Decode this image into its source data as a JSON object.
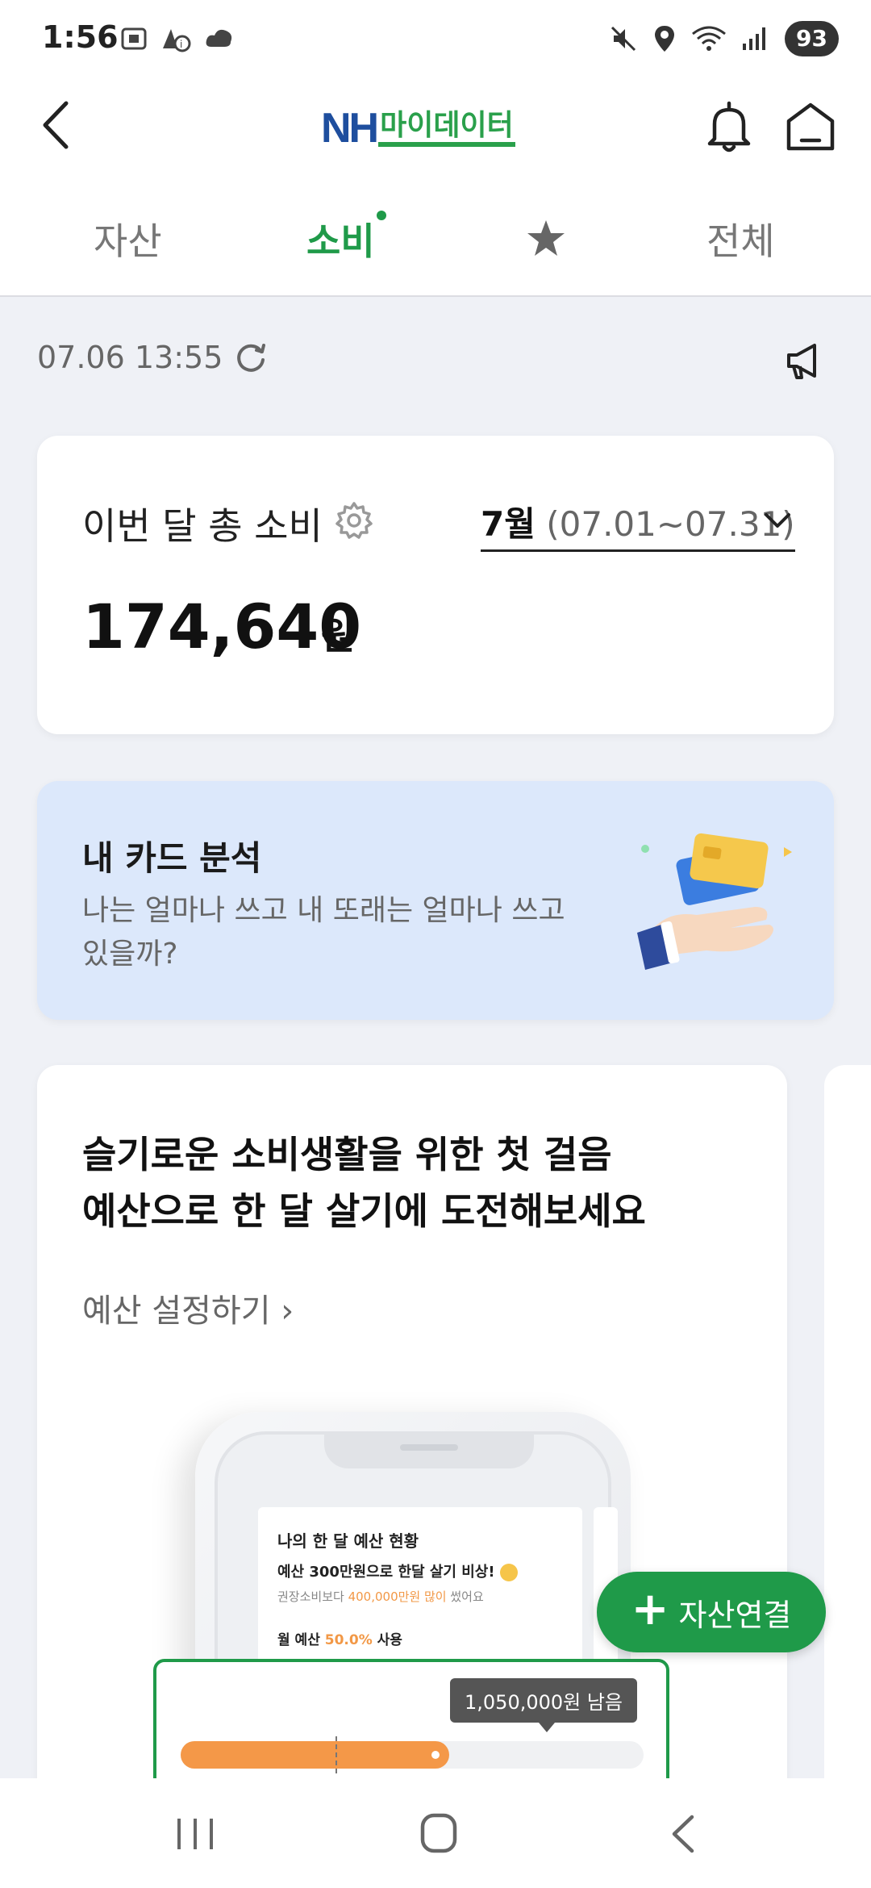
{
  "status_bar": {
    "time": "1:56",
    "battery": "93"
  },
  "header": {
    "logo_nh": "NH",
    "logo_text": "마이데이터"
  },
  "tabs": [
    {
      "label": "자산"
    },
    {
      "label": "소비"
    },
    {
      "label": "star-icon"
    },
    {
      "label": "전체"
    }
  ],
  "update": {
    "time": "07.06 13:55"
  },
  "total_card": {
    "label": "이번 달 총 소비",
    "month": "7월",
    "range": "(07.01~07.31)",
    "amount": "174,640",
    "unit": "원"
  },
  "banner": {
    "title": "내 카드 분석",
    "desc": "나는 얼마나 쓰고 내 또래는 얼마나 쓰고 있을까?"
  },
  "budget_card": {
    "title_line1": "슬기로운 소비생활을 위한 첫 걸음",
    "title_line2": "예산으로 한 달 살기에 도전해보세요",
    "link": "예산 설정하기",
    "mock": {
      "title": "나의 한 달 예산 현황",
      "sub": "예산 300만원으로 한달 살기 비상!",
      "note_prefix": "권장소비보다",
      "note_highlight": "400,000만원 많이",
      "note_suffix": "썼어요",
      "usage_prefix": "월 예산",
      "usage_highlight": "50.0%",
      "usage_suffix": "사용",
      "tooltip": "1,050,000원 남음",
      "progress_fraction": 0.58
    }
  },
  "fab": {
    "label": "자산연결"
  },
  "colors": {
    "accent_green": "#1f9a49",
    "logo_blue": "#1e4e9e",
    "progress_orange": "#f49848",
    "banner_blue": "#dce8fb"
  }
}
